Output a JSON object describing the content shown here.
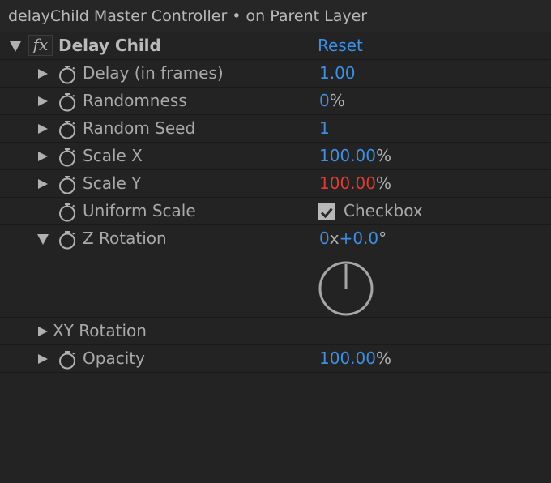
{
  "panel": {
    "title": "delayChild Master Controller • on Parent Layer"
  },
  "effect": {
    "fx_label": "fx",
    "name": "Delay Child",
    "reset_label": "Reset"
  },
  "properties": {
    "delay": {
      "label": "Delay (in frames)",
      "value": "1.00"
    },
    "randomness": {
      "label": "Randomness",
      "value": "0",
      "unit": "%"
    },
    "random_seed": {
      "label": "Random Seed",
      "value": "1"
    },
    "scale_x": {
      "label": "Scale X",
      "value": "100.00",
      "unit": "%"
    },
    "scale_y": {
      "label": "Scale Y",
      "value": "100.00",
      "unit": "%"
    },
    "uniform_scale": {
      "label": "Uniform Scale",
      "checkbox_label": "Checkbox",
      "checked": true
    },
    "z_rotation": {
      "label": "Z Rotation",
      "revolutions": "0",
      "x_sep": "x",
      "degrees": "+0.0",
      "deg_sign": "°"
    },
    "xy_rotation": {
      "label": "XY Rotation"
    },
    "opacity": {
      "label": "Opacity",
      "value": "100.00",
      "unit": "%"
    }
  },
  "colors": {
    "background": "#232323",
    "value_blue": "#3a8fe6",
    "value_red": "#e03a32",
    "text_gray": "#a9a9a9"
  },
  "icons": {
    "expand": "triangle-right-icon",
    "collapse": "triangle-down-icon",
    "keyframe": "stopwatch-icon",
    "check": "checkmark-icon",
    "angle": "rotation-dial-icon"
  }
}
